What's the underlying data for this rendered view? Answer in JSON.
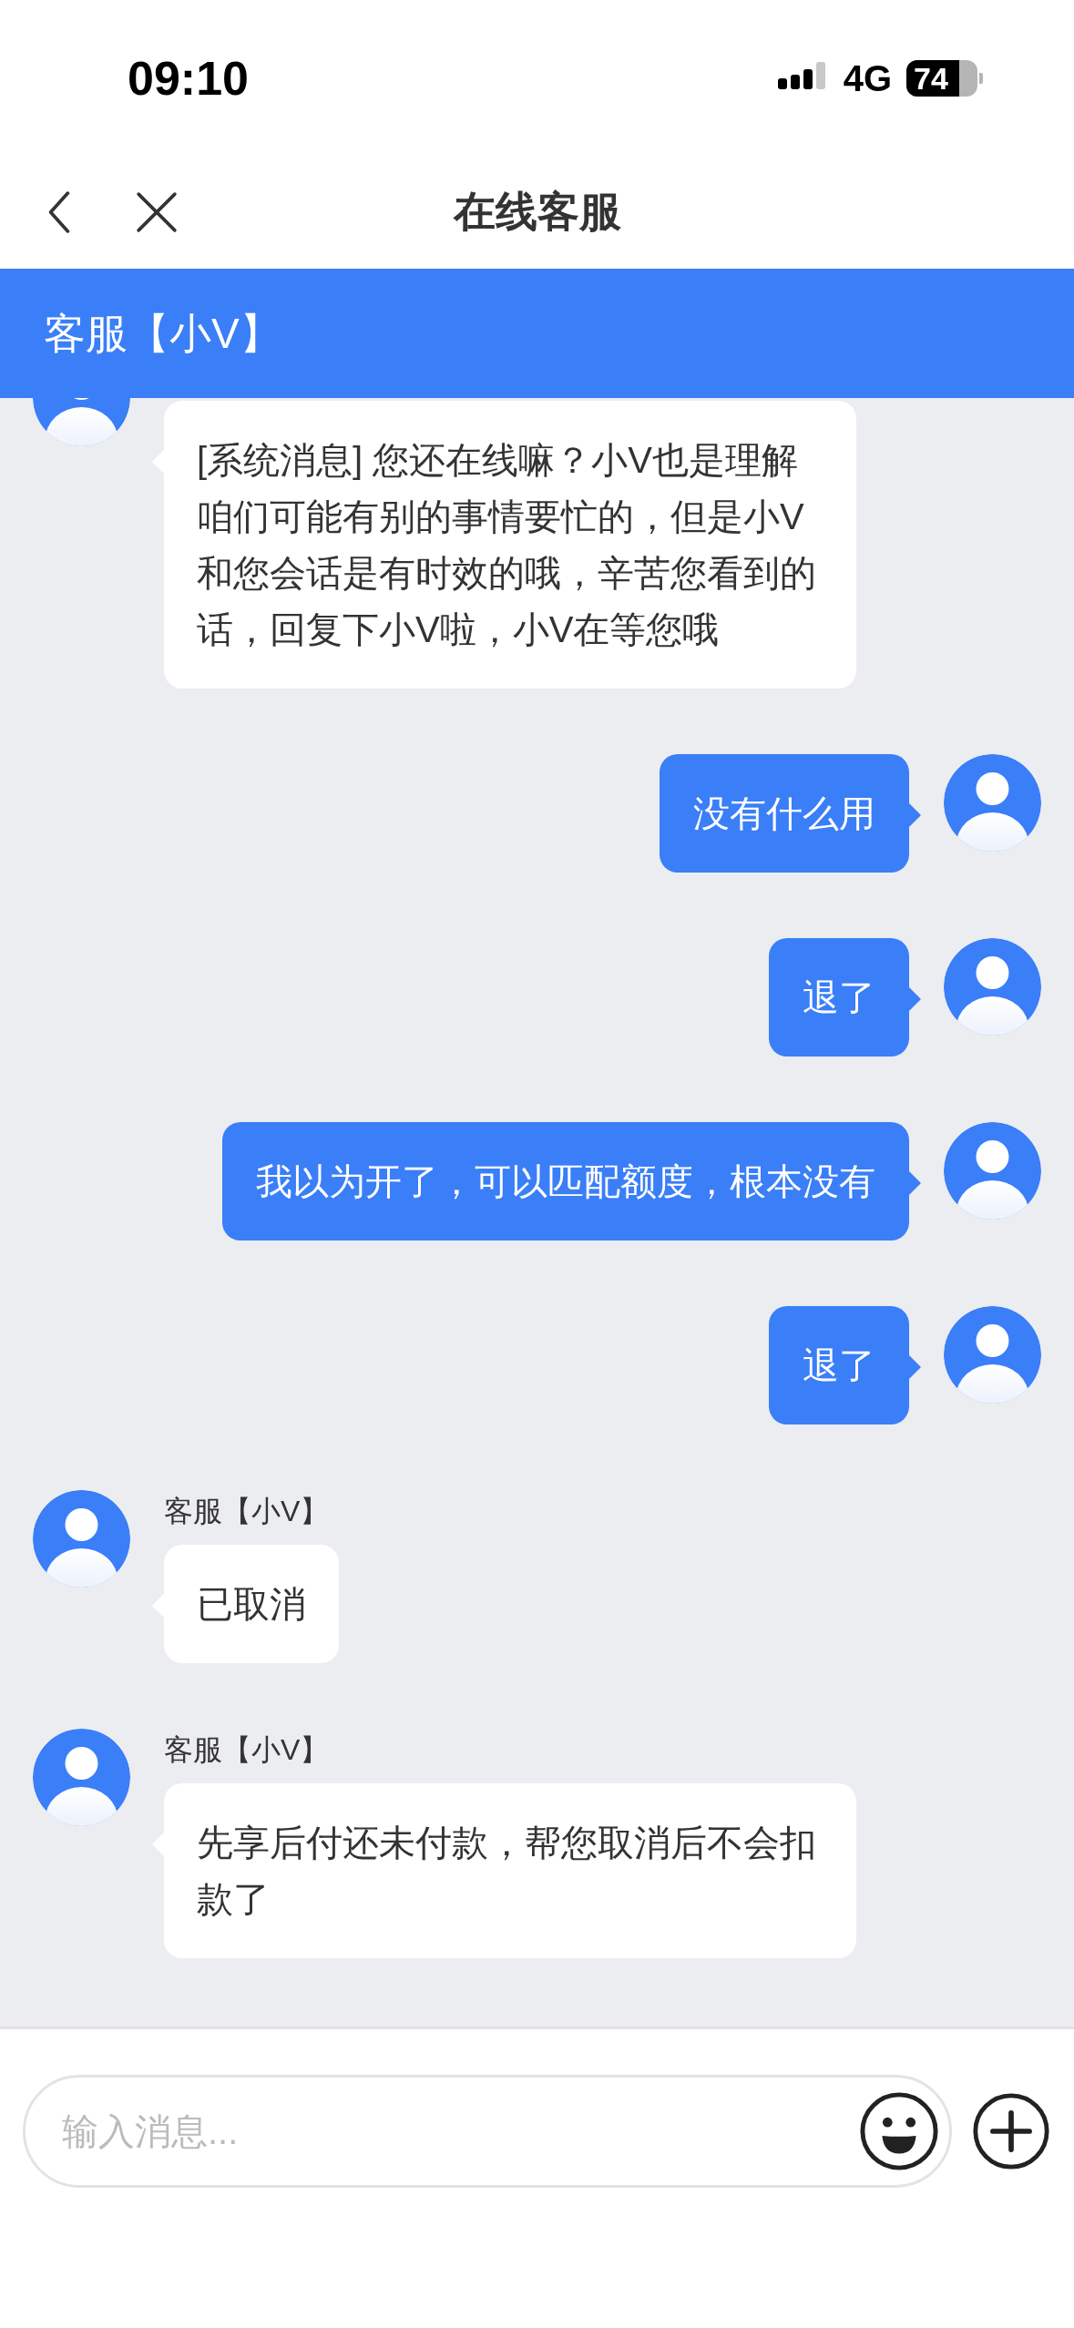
{
  "status_bar": {
    "time": "09:10",
    "network": "4G",
    "battery": "74"
  },
  "nav": {
    "title": "在线客服"
  },
  "chat_header": {
    "title": "客服【小V】"
  },
  "messages": [
    {
      "kind": "agent",
      "text": "[系统消息] 您还在线嘛？小V也是理解咱们可能有别的事情要忙的，但是小V和您会话是有时效的哦，辛苦您看到的话，回复下小V啦，小V在等您哦"
    },
    {
      "kind": "user",
      "text": "没有什么用"
    },
    {
      "kind": "user",
      "text": "退了"
    },
    {
      "kind": "user",
      "text": "我以为开了，可以匹配额度，根本没有"
    },
    {
      "kind": "user",
      "text": "退了"
    },
    {
      "kind": "agent",
      "name": "客服【小V】",
      "text": "已取消"
    },
    {
      "kind": "agent",
      "name": "客服【小V】",
      "text": "先享后付还未付款，帮您取消后不会扣款了"
    }
  ],
  "composer": {
    "placeholder": "输入消息..."
  }
}
